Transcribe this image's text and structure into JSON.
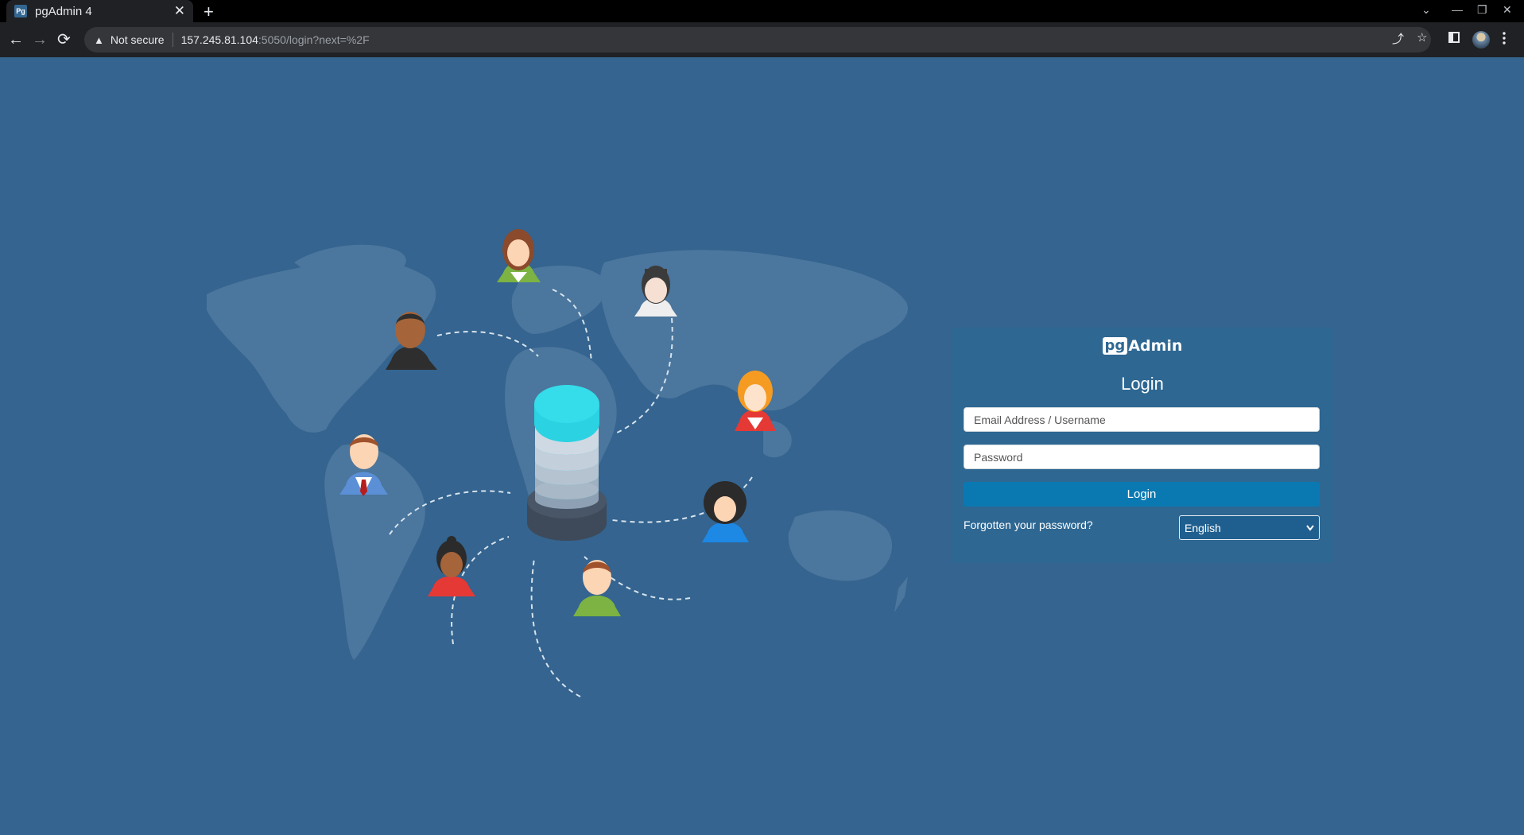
{
  "browser": {
    "tab_title": "pgAdmin 4",
    "favicon_text": "Pg",
    "security_label": "Not secure",
    "url_host": "157.245.81.104",
    "url_path": ":5050/login?next=%2F"
  },
  "login": {
    "brand_pg": "pg",
    "brand_rest": "Admin",
    "title": "Login",
    "email_placeholder": "Email Address / Username",
    "password_placeholder": "Password",
    "login_button": "Login",
    "forgot_link": "Forgotten your password?",
    "language_selected": "English"
  },
  "colors": {
    "page_background": "#34648f",
    "card_background": "#2e6792",
    "login_button": "#0a79b2"
  },
  "icons": [
    "warning-icon",
    "back-icon",
    "forward-icon",
    "reload-icon",
    "share-icon",
    "star-icon",
    "sidepanel-icon",
    "menu-icon",
    "database-icon"
  ]
}
